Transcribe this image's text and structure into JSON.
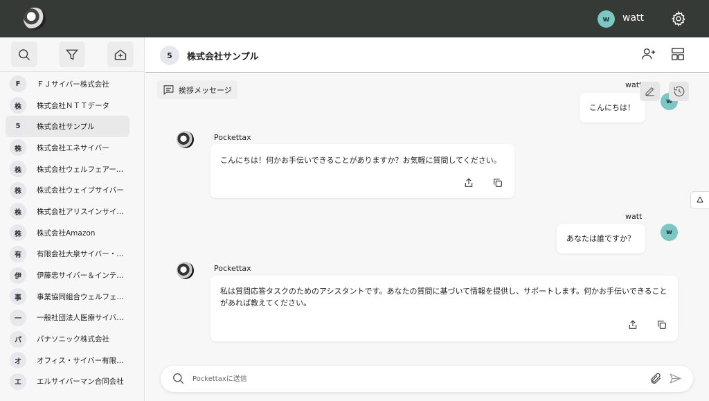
{
  "topbar": {
    "user_initial": "w",
    "user_name": "watt",
    "logo_icon": "pockettax-logo",
    "settings_icon": "gear-icon"
  },
  "sidebar": {
    "tools": [
      "search-icon",
      "filter-icon",
      "new-home-icon"
    ],
    "items": [
      {
        "badge": "F",
        "label": "ＦＪサイバー株式会社"
      },
      {
        "badge": "株",
        "label": "株式会社ＮＴＴデータ"
      },
      {
        "badge": "5",
        "label": "株式会社サンプル"
      },
      {
        "badge": "株",
        "label": "株式会社エネサイバー"
      },
      {
        "badge": "株",
        "label": "株式会社ウェルフェアーサ…"
      },
      {
        "badge": "株",
        "label": "株式会社ウェイブサイバー"
      },
      {
        "badge": "株",
        "label": "株式会社アリスインサイバ…"
      },
      {
        "badge": "株",
        "label": "株式会社Amazon"
      },
      {
        "badge": "有",
        "label": "有限会社大泉サイバー・ト…"
      },
      {
        "badge": "伊",
        "label": "伊藤忠サイバー＆インテリ…"
      },
      {
        "badge": "事",
        "label": "事業協同組合ウェルフェア…"
      },
      {
        "badge": "一",
        "label": "一般社団法人医療サイバー…"
      },
      {
        "badge": "パ",
        "label": "パナソニック株式会社"
      },
      {
        "badge": "オ",
        "label": "オフィス・サイバー有限会社"
      },
      {
        "badge": "エ",
        "label": "エルサイバーマン合同会社"
      }
    ],
    "active_index": 2
  },
  "header": {
    "badge": "5",
    "title": "株式会社サンプル"
  },
  "chat": {
    "greeting_chip": "挨拶メッセージ",
    "messages": [
      {
        "role": "user",
        "sender": "watt",
        "initial": "w",
        "text": "こんにちは！"
      },
      {
        "role": "bot",
        "sender": "Pockettax",
        "text": "こんにちは！何かお手伝いできることがありますか？お気軽に質問してください。"
      },
      {
        "role": "user",
        "sender": "watt",
        "initial": "w",
        "text": "あなたは誰ですか？"
      },
      {
        "role": "bot",
        "sender": "Pockettax",
        "text": "私は質問応答タスクのためのアシスタントです。あなたの質問に基づいて情報を提供し、サポートします。何かお手伝いできることがあれば教えてください。"
      }
    ]
  },
  "composer": {
    "placeholder": "Pockettaxに送信"
  },
  "colors": {
    "topbar": "#363a37",
    "avatar": "#7cc7c3",
    "chat_bg": "#f7f7f7"
  }
}
